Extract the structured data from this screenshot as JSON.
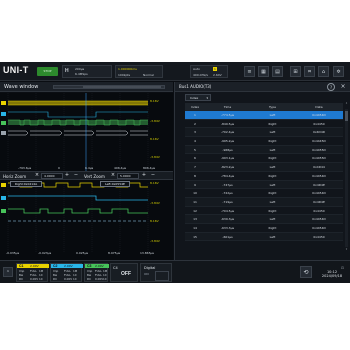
{
  "topbar": {
    "logo": "UNI-T",
    "run_state": "STOP",
    "horizontal": {
      "letter": "H",
      "scale": "200µs",
      "rate": "6.4MSps"
    },
    "time": {
      "delay": "1.000000ms",
      "depth": "100kpts",
      "mode": "Normal"
    },
    "trigger": {
      "mode": "Auto",
      "rate": "400.0Hz/s",
      "source_badge": "1",
      "level": "2.64V"
    }
  },
  "wave_window": {
    "title": "Wave window",
    "trace_levels": [
      "8.16V",
      "-3.84V",
      "8.16V",
      "-3.84V"
    ],
    "time_labels_top": [
      "-793.6µs",
      "0",
      "6.4µs",
      "406.4µs",
      "806.4µs"
    ],
    "horiz_zoom": {
      "label": "Horiz Zoom",
      "value": "4.0000"
    },
    "vert_zoom": {
      "label": "Vert Zoom",
      "value": "5.0000"
    },
    "bus_tags": [
      "Right:0x0214A",
      "Left:0x0554E"
    ],
    "zoom_levels": [
      "8.16V",
      "-3.84V",
      "8.16V",
      "-3.84V"
    ],
    "time_labels_bottom": [
      "-0.035µs",
      "-0.023µs",
      "0.025µs",
      "8.975µs",
      "13.865µs"
    ]
  },
  "panel": {
    "title": "Bus1 AUDIO(T3)",
    "index_select": "Index",
    "columns": [
      "Index",
      "Time",
      "Type",
      "Data"
    ],
    "rows": [
      [
        "1",
        "-774.5µs",
        "Left",
        "0x4454D"
      ],
      [
        "2",
        "-849.5µs",
        "Right",
        "0x4450"
      ],
      [
        "3",
        "-702.4µs",
        "Left",
        "0x4D4D"
      ],
      [
        "4",
        "-995.2µs",
        "Right",
        "0x4445D"
      ],
      [
        "5",
        "-968µs",
        "Left",
        "0x4455D"
      ],
      [
        "6",
        "-993.1µs",
        "Right",
        "0x4455D"
      ],
      [
        "7",
        "-823.2µs",
        "Left",
        "0x4D44"
      ],
      [
        "8",
        "-784.4µs",
        "Right",
        "0x4454D"
      ],
      [
        "9",
        "-747µs",
        "Left",
        "0x4D4E"
      ],
      [
        "10",
        "-722µs",
        "Right",
        "0x4454D"
      ],
      [
        "11",
        "-719µs",
        "Left",
        "0x4D4E"
      ],
      [
        "12",
        "-704.5µs",
        "Right",
        "0x4450"
      ],
      [
        "13",
        "-639.3µs",
        "Left",
        "0x4454D"
      ],
      [
        "14",
        "-633.3µs",
        "Right",
        "0x4454D"
      ],
      [
        "15",
        "-601µs",
        "Left",
        "0x4450"
      ]
    ]
  },
  "channels": [
    {
      "name": "C1",
      "volts": "2.00V",
      "color": "#e8d200",
      "rows": [
        [
          "Imp",
          "FULL",
          "1M"
        ],
        [
          "Bw",
          "FULL",
          "1X"
        ],
        [
          "DC",
          "0.00V",
          "1X"
        ]
      ]
    },
    {
      "name": "C2",
      "volts": "2.00V",
      "color": "#29b6e8",
      "rows": [
        [
          "Imp",
          "FULL",
          "1M"
        ],
        [
          "Bw",
          "FULL",
          "1X"
        ],
        [
          "DC",
          "0.00V",
          "1X"
        ]
      ]
    },
    {
      "name": "C3",
      "volts": "2.00V",
      "color": "#47c35a",
      "rows": [
        [
          "Imp",
          "FULL",
          "1M"
        ],
        [
          "Bw",
          "FULL",
          "1X"
        ],
        [
          "DC",
          "0.00V",
          "1X"
        ]
      ]
    }
  ],
  "c4": {
    "name": "C4",
    "state": "OFF"
  },
  "digital": {
    "label": "Digital",
    "state": "ON"
  },
  "clock": {
    "time": "10:12",
    "date": "2024/09/18"
  }
}
